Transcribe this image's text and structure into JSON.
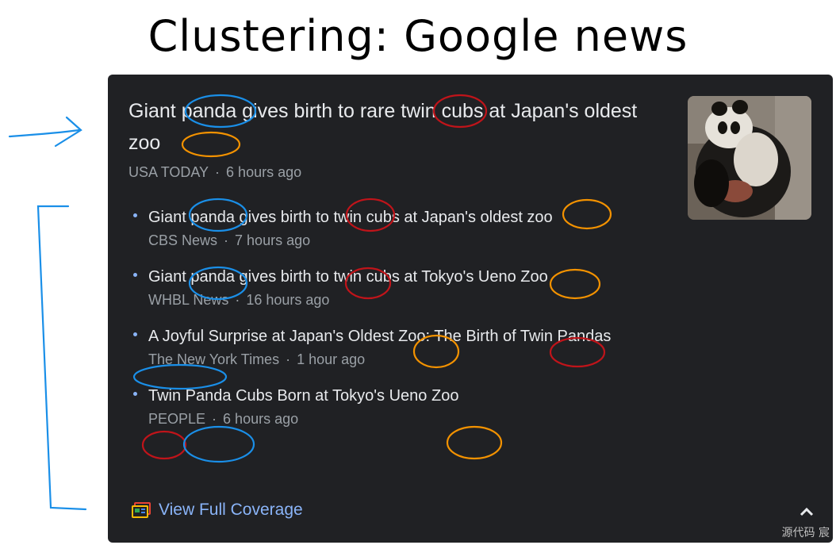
{
  "slide": {
    "title": "Clustering: Google news"
  },
  "card": {
    "headline": {
      "title": "Giant panda gives birth to rare twin cubs at Japan's oldest zoo",
      "source": "USA TODAY",
      "separator": "·",
      "time": "6 hours ago",
      "thumbnail_icon": "panda-photo-thumbnail"
    },
    "related": [
      {
        "title": "Giant panda gives birth to twin cubs at Japan's oldest zoo",
        "source": "CBS News",
        "time": "7 hours ago"
      },
      {
        "title": "Giant panda gives birth to twin cubs at Tokyo's Ueno Zoo",
        "source": "WHBL News",
        "time": "16 hours ago"
      },
      {
        "title": "A Joyful Surprise at Japan's Oldest Zoo: The Birth of Twin Pandas",
        "source": "The New York Times",
        "time": "1 hour ago"
      },
      {
        "title": "Twin Panda Cubs Born at Tokyo's Ueno Zoo",
        "source": "PEOPLE",
        "time": "6 hours ago"
      }
    ],
    "coverage_label": "View Full Coverage",
    "coverage_icon": "newspaper-icon",
    "collapse_icon": "chevron-up-icon"
  },
  "watermark": "源代码  宸",
  "colors": {
    "card_bg": "#202124",
    "title_text": "#e8eaed",
    "meta_text": "#9aa0a6",
    "link_blue": "#8ab4f8",
    "annotation_blue": "#1a8fe8",
    "annotation_red": "#c0141a",
    "annotation_orange": "#f39200"
  }
}
